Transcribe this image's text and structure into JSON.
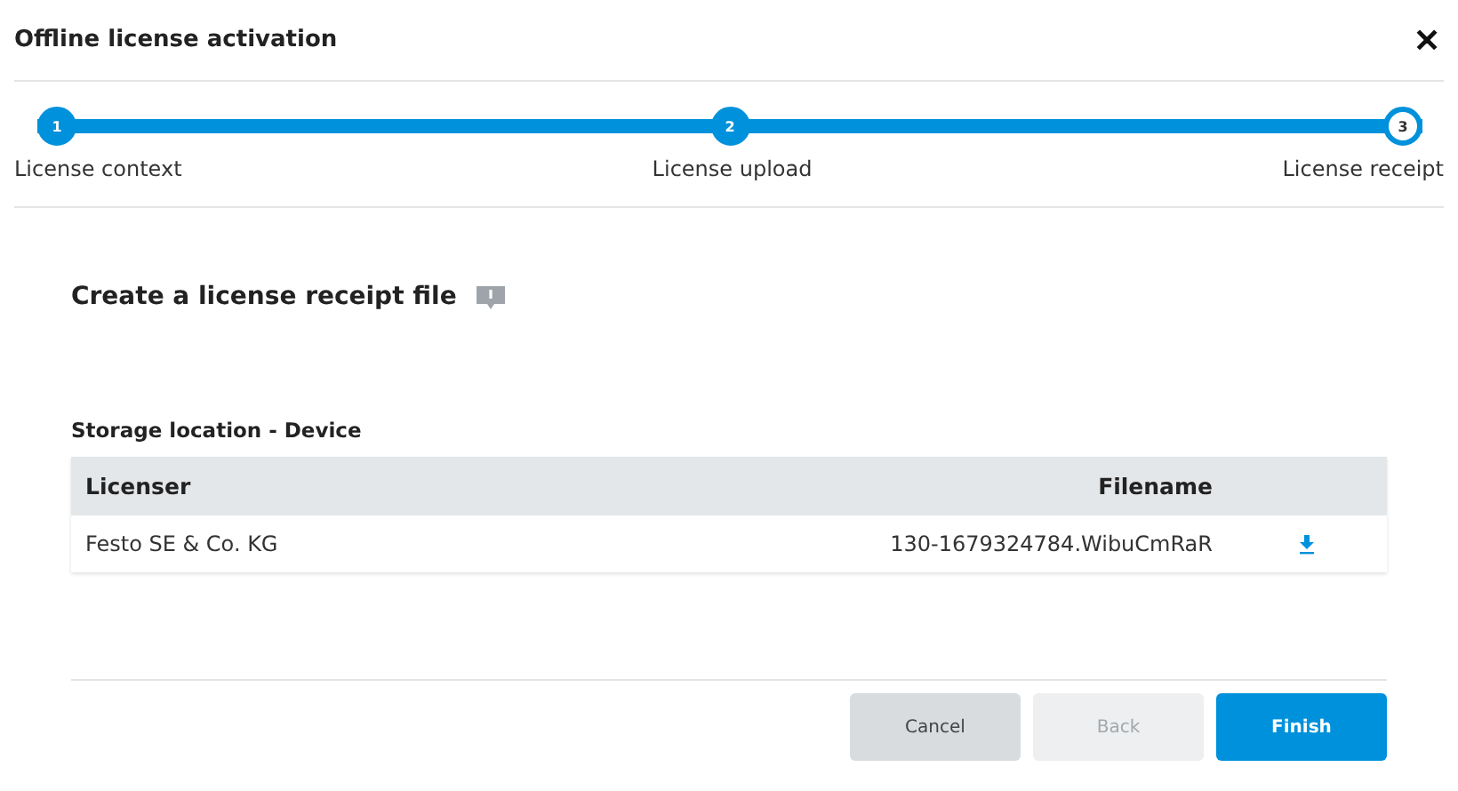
{
  "window": {
    "title": "Offline license activation",
    "close": "✕"
  },
  "steps": [
    {
      "number": "1",
      "label": "License context",
      "selected": false
    },
    {
      "number": "2",
      "label": "License upload",
      "selected": false
    },
    {
      "number": "3",
      "label": "License receipt",
      "selected": true
    }
  ],
  "heading": "Create a license receipt file",
  "storage_label": "Storage location - Device",
  "table": {
    "columns": [
      "Licenser",
      "Filename"
    ],
    "rows": [
      {
        "licenser": "Festo SE & Co. KG",
        "filename": "130-1679324784.WibuCmRaR"
      }
    ]
  },
  "buttons": [
    {
      "label": "Cancel",
      "kind": "secondary",
      "disabled": false
    },
    {
      "label": "Back",
      "kind": "secondary",
      "disabled": true
    },
    {
      "label": "Finish",
      "kind": "primary",
      "disabled": false
    }
  ]
}
